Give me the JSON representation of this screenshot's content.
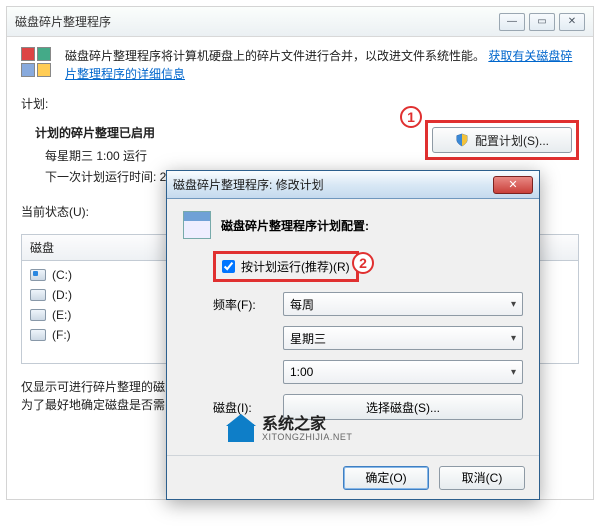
{
  "main": {
    "title": "磁盘碎片整理程序",
    "info_text": "磁盘碎片整理程序将计算机硬盘上的碎片文件进行合并，以改进文件系统性能。",
    "info_link": "获取有关磁盘碎片整理程序的详细信息",
    "schedule_label": "计划:",
    "schedule_heading": "计划的碎片整理已启用",
    "schedule_when": "每星期三  1:00 运行",
    "schedule_next_prefix": "下一次计划运行时间: 2",
    "config_button": "配置计划(S)...",
    "status_label": "当前状态(U):",
    "disk_header": "磁盘",
    "drives": [
      {
        "label": "(C:)",
        "kind": "c"
      },
      {
        "label": "(D:)",
        "kind": "d"
      },
      {
        "label": "(E:)",
        "kind": "e"
      },
      {
        "label": "(F:)",
        "kind": "f"
      }
    ],
    "footer_line1": "仅显示可进行碎片整理的磁",
    "footer_line2": "为了最好地确定磁盘是否需"
  },
  "dialog": {
    "title": "磁盘碎片整理程序: 修改计划",
    "header_label": "磁盘碎片整理程序计划配置:",
    "checkbox_label": "按计划运行(推荐)(R)",
    "freq_label": "频率(F):",
    "freq_value": "每周",
    "day_value": "星期三",
    "time_value": "1:00",
    "disk_label": "磁盘(I):",
    "select_disks_btn": "选择磁盘(S)...",
    "ok_btn": "确定(O)",
    "cancel_btn": "取消(C)"
  },
  "annotations": {
    "one": "1",
    "two": "2"
  },
  "watermark": {
    "cn": "系统之家",
    "en": "XITONGZHIJIA.NET"
  },
  "winbtns": {
    "min": "—",
    "max": "▭",
    "close": "✕"
  }
}
